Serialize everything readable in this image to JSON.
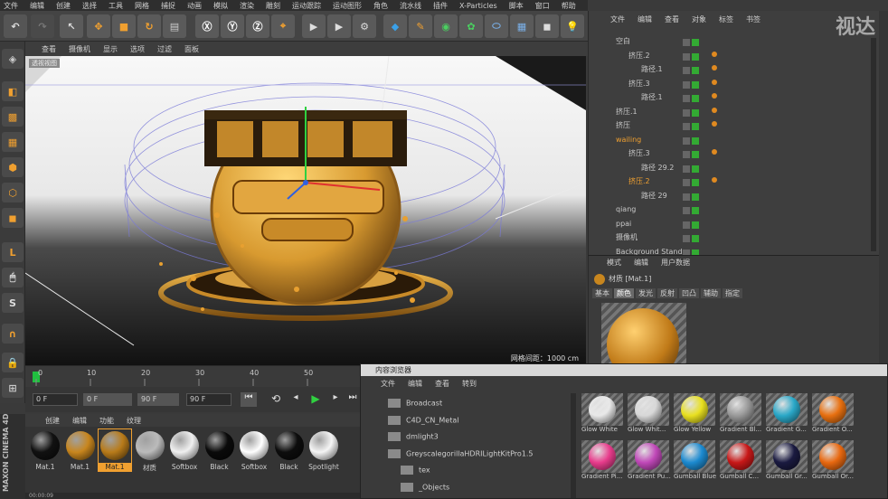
{
  "menubar": [
    "文件",
    "编辑",
    "创建",
    "选择",
    "工具",
    "网格",
    "捕捉",
    "动画",
    "模拟",
    "渲染",
    "雕刻",
    "运动跟踪",
    "运动图形",
    "角色",
    "流水线",
    "插件",
    "X-Particles",
    "脚本",
    "窗口",
    "帮助"
  ],
  "viewport_menu": [
    "查看",
    "摄像机",
    "显示",
    "选项",
    "过滤",
    "面板"
  ],
  "viewport_label": "透视视图",
  "grid_spacing": "网格间距：1000 cm",
  "watermark": "视达",
  "object_manager": {
    "menu": [
      "文件",
      "编辑",
      "查看",
      "对象",
      "标签",
      "书签"
    ],
    "rows": [
      {
        "name": "空白",
        "indent": 0
      },
      {
        "name": "挤压.2",
        "indent": 1
      },
      {
        "name": "路径.1",
        "indent": 2
      },
      {
        "name": "挤压.3",
        "indent": 1
      },
      {
        "name": "路径.1",
        "indent": 2
      },
      {
        "name": "挤压.1",
        "indent": 0
      },
      {
        "name": "挤压",
        "indent": 0
      },
      {
        "name": "wailing",
        "indent": 0
      },
      {
        "name": "挤压.3",
        "indent": 1
      },
      {
        "name": "路径 29.2",
        "indent": 2
      },
      {
        "name": "挤压.2",
        "indent": 1
      },
      {
        "name": "路径 29",
        "indent": 2
      },
      {
        "name": "qiang",
        "indent": 0
      },
      {
        "name": "ppai",
        "indent": 0
      },
      {
        "name": "摄像机",
        "indent": 0
      },
      {
        "name": "Background Stand",
        "indent": 0
      }
    ]
  },
  "attribute_manager": {
    "menu": [
      "模式",
      "编辑",
      "用户数据"
    ],
    "title": "材质 [Mat.1]",
    "tabs": [
      "基本",
      "颜色",
      "发光",
      "反射",
      "凹凸",
      "辅助",
      "指定"
    ],
    "active_tab": "颜色"
  },
  "timeline": {
    "ticks": [
      "0",
      "10",
      "20",
      "30",
      "40",
      "50"
    ],
    "fields": [
      "0 F",
      "0 F",
      "90 F",
      "90 F"
    ]
  },
  "material_manager": {
    "menu": [
      "创建",
      "编辑",
      "功能",
      "纹理"
    ],
    "materials": [
      {
        "label": "Mat.1",
        "color": "#111111"
      },
      {
        "label": "Mat.1",
        "color": "#c8861e"
      },
      {
        "label": "Mat.1",
        "color": "#b87b1a"
      },
      {
        "label": "材质",
        "color": "#bbbbbb"
      },
      {
        "label": "Softbox",
        "color": "#f0f0f0"
      },
      {
        "label": "Black",
        "color": "#0a0a0a"
      },
      {
        "label": "Softbox",
        "color": "#ffffff"
      },
      {
        "label": "Black",
        "color": "#0d0d0d"
      },
      {
        "label": "Spotlight",
        "color": "#f5f5f5"
      }
    ]
  },
  "brand": "MAXON CINEMA 4D",
  "status_text": "00:00:09",
  "content_browser": {
    "title": "内容浏览器",
    "menu": [
      "文件",
      "编辑",
      "查看",
      "转到"
    ],
    "tree": [
      "Broadcast",
      "C4D_CN_Metal",
      "dmlight3",
      "GreyscalegorillaHDRILightKitPro1.5",
      "tex",
      "_Objects"
    ],
    "presets": [
      {
        "label": "Glow White",
        "color": "#e8e8e8"
      },
      {
        "label": "Glow Whit...",
        "color": "#d8d8d8"
      },
      {
        "label": "Glow Yellow",
        "color": "#e8e020"
      },
      {
        "label": "Gradient Bl...",
        "color": "#9a9a9a"
      },
      {
        "label": "Gradient G...",
        "color": "#2aa8c8"
      },
      {
        "label": "Gradient O...",
        "color": "#e87010"
      },
      {
        "label": "Gradient Pi...",
        "color": "#e83c8c"
      },
      {
        "label": "Gradient Pu...",
        "color": "#c048b8"
      },
      {
        "label": "Gumball Blue",
        "color": "#1c8ad0"
      },
      {
        "label": "Gumball C...",
        "color": "#c81818"
      },
      {
        "label": "Gumball Gr...",
        "color": "#1a1a40"
      },
      {
        "label": "Gumball Or...",
        "color": "#e86810"
      }
    ]
  },
  "colors": {
    "accent": "#f0a030",
    "selection": "#f0a030"
  }
}
